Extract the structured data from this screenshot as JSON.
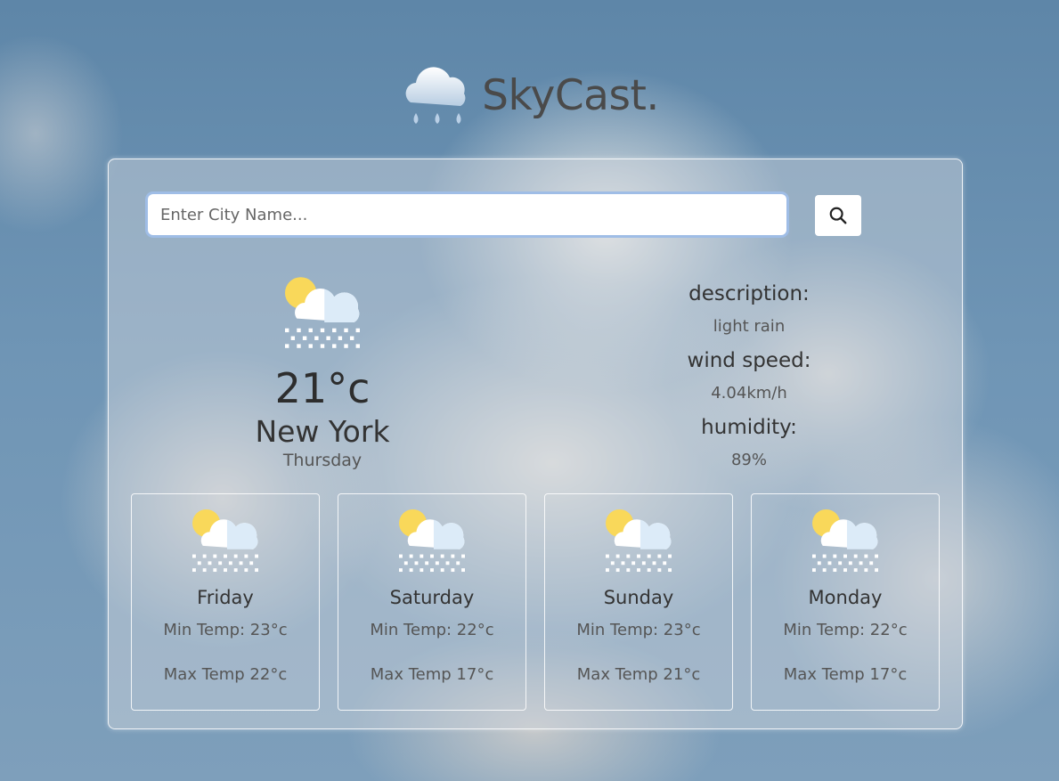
{
  "app": {
    "title": "SkyCast.",
    "logo_icon": "rain-cloud-icon"
  },
  "search": {
    "placeholder": "Enter City Name...",
    "value": "",
    "button_icon": "search-icon"
  },
  "current": {
    "icon": "partly-cloudy-snow-icon",
    "temperature": "21°c",
    "city": "New York",
    "day": "Thursday"
  },
  "details": {
    "description_label": "description:",
    "description_value": "light rain",
    "wind_label": "wind speed:",
    "wind_value": "4.04km/h",
    "humidity_label": "humidity:",
    "humidity_value": "89%"
  },
  "forecast": [
    {
      "day": "Friday",
      "min": "Min Temp: 23°c",
      "max": "Max Temp 22°c",
      "icon": "partly-cloudy-snow-icon"
    },
    {
      "day": "Saturday",
      "min": "Min Temp: 22°c",
      "max": "Max Temp 17°c",
      "icon": "partly-cloudy-snow-icon"
    },
    {
      "day": "Sunday",
      "min": "Min Temp: 23°c",
      "max": "Max Temp 21°c",
      "icon": "partly-cloudy-snow-icon"
    },
    {
      "day": "Monday",
      "min": "Min Temp: 22°c",
      "max": "Max Temp 17°c",
      "icon": "partly-cloudy-snow-icon"
    }
  ],
  "colors": {
    "sun": "#f9d85a",
    "cloud": "#ffffff",
    "cloud_shade": "#dcebf8",
    "rain_drop": "#c8dbef",
    "text_dark": "#333333"
  }
}
